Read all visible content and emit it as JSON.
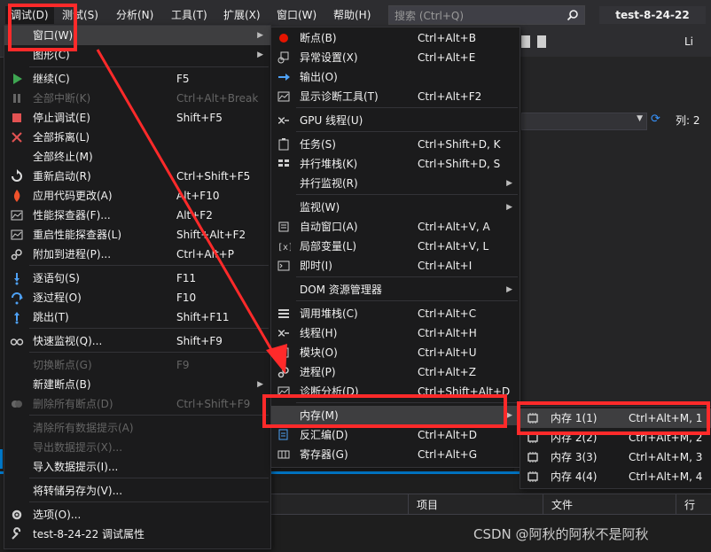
{
  "menubar": {
    "items": [
      {
        "label": "调试(D)"
      },
      {
        "label": "测试(S)"
      },
      {
        "label": "分析(N)"
      },
      {
        "label": "工具(T)"
      },
      {
        "label": "扩展(X)"
      },
      {
        "label": "窗口(W)"
      },
      {
        "label": "帮助(H)"
      }
    ],
    "search_placeholder": "搜索 (Ctrl+Q)",
    "window_title": "test-8-24-22"
  },
  "background": {
    "live_label": "Li",
    "col_label": "列: 2",
    "grid_headers": [
      "项目",
      "文件",
      "行"
    ],
    "watermark": "CSDN @阿秋的阿秋不是阿秋"
  },
  "debug_menu": {
    "items": [
      {
        "label": "窗口(W)",
        "shortcut": "",
        "icon": "",
        "submenu": true
      },
      {
        "label": "图形(C)",
        "shortcut": "",
        "icon": "",
        "submenu": true
      },
      {
        "label": "继续(C)",
        "shortcut": "F5",
        "icon": "play-icon"
      },
      {
        "label": "全部中断(K)",
        "shortcut": "Ctrl+Alt+Break",
        "icon": "pause-icon",
        "disabled": true
      },
      {
        "label": "停止调试(E)",
        "shortcut": "Shift+F5",
        "icon": "stop-icon"
      },
      {
        "label": "全部拆离(L)",
        "shortcut": "",
        "icon": "close-icon"
      },
      {
        "label": "全部终止(M)",
        "shortcut": "",
        "icon": ""
      },
      {
        "label": "重新启动(R)",
        "shortcut": "Ctrl+Shift+F5",
        "icon": "restart-icon"
      },
      {
        "label": "应用代码更改(A)",
        "shortcut": "Alt+F10",
        "icon": "flame-icon"
      },
      {
        "label": "性能探查器(F)...",
        "shortcut": "Alt+F2",
        "icon": "profiler-icon"
      },
      {
        "label": "重启性能探查器(L)",
        "shortcut": "Shift+Alt+F2",
        "icon": "profiler-restart-icon"
      },
      {
        "label": "附加到进程(P)...",
        "shortcut": "Ctrl+Alt+P",
        "icon": "gears-icon"
      },
      {
        "label": "逐语句(S)",
        "shortcut": "F11",
        "icon": "step-into-icon"
      },
      {
        "label": "逐过程(O)",
        "shortcut": "F10",
        "icon": "step-over-icon"
      },
      {
        "label": "跳出(T)",
        "shortcut": "Shift+F11",
        "icon": "step-out-icon"
      },
      {
        "label": "快速监视(Q)...",
        "shortcut": "Shift+F9",
        "icon": "glasses-icon"
      },
      {
        "label": "切换断点(G)",
        "shortcut": "F9",
        "icon": "",
        "disabled": true
      },
      {
        "label": "新建断点(B)",
        "shortcut": "",
        "icon": "",
        "submenu": true
      },
      {
        "label": "删除所有断点(D)",
        "shortcut": "Ctrl+Shift+F9",
        "icon": "breakpoints-icon",
        "disabled": true
      },
      {
        "label": "清除所有数据提示(A)",
        "shortcut": "",
        "icon": "",
        "disabled": true
      },
      {
        "label": "导出数据提示(X)...",
        "shortcut": "",
        "icon": "",
        "disabled": true
      },
      {
        "label": "导入数据提示(I)...",
        "shortcut": "",
        "icon": ""
      },
      {
        "label": "将转储另存为(V)...",
        "shortcut": "",
        "icon": ""
      },
      {
        "label": "选项(O)...",
        "shortcut": "",
        "icon": "gear-icon"
      },
      {
        "label": "test-8-24-22 调试属性",
        "shortcut": "",
        "icon": "wrench-icon"
      }
    ]
  },
  "window_menu": {
    "items": [
      {
        "label": "断点(B)",
        "shortcut": "Ctrl+Alt+B",
        "icon": "breakpoint-icon"
      },
      {
        "label": "异常设置(X)",
        "shortcut": "Ctrl+Alt+E",
        "icon": "exception-icon"
      },
      {
        "label": "输出(O)",
        "shortcut": "",
        "icon": "output-icon"
      },
      {
        "label": "显示诊断工具(T)",
        "shortcut": "Ctrl+Alt+F2",
        "icon": "diagnostics-icon"
      },
      {
        "label": "GPU 线程(U)",
        "shortcut": "",
        "icon": "threads-icon"
      },
      {
        "label": "任务(S)",
        "shortcut": "Ctrl+Shift+D, K",
        "icon": "task-icon"
      },
      {
        "label": "并行堆栈(K)",
        "shortcut": "Ctrl+Shift+D, S",
        "icon": "parallel-stacks-icon"
      },
      {
        "label": "并行监视(R)",
        "shortcut": "",
        "icon": "",
        "submenu": true
      },
      {
        "label": "监视(W)",
        "shortcut": "",
        "icon": "",
        "submenu": true
      },
      {
        "label": "自动窗口(A)",
        "shortcut": "Ctrl+Alt+V, A",
        "icon": "autos-icon"
      },
      {
        "label": "局部变量(L)",
        "shortcut": "Ctrl+Alt+V, L",
        "icon": "locals-icon"
      },
      {
        "label": "即时(I)",
        "shortcut": "Ctrl+Alt+I",
        "icon": "immediate-icon"
      },
      {
        "label": "DOM 资源管理器",
        "shortcut": "",
        "icon": "",
        "submenu": true
      },
      {
        "label": "调用堆栈(C)",
        "shortcut": "Ctrl+Alt+C",
        "icon": "call-stack-icon"
      },
      {
        "label": "线程(H)",
        "shortcut": "Ctrl+Alt+H",
        "icon": "threads-icon"
      },
      {
        "label": "模块(O)",
        "shortcut": "Ctrl+Alt+U",
        "icon": "modules-icon"
      },
      {
        "label": "进程(P)",
        "shortcut": "Ctrl+Alt+Z",
        "icon": "process-icon"
      },
      {
        "label": "诊断分析(D)",
        "shortcut": "Ctrl+Shift+Alt+D",
        "icon": "diagnostics-icon"
      },
      {
        "label": "内存(M)",
        "shortcut": "",
        "icon": "",
        "submenu": true
      },
      {
        "label": "反汇编(D)",
        "shortcut": "Ctrl+Alt+D",
        "icon": "disassembly-icon"
      },
      {
        "label": "寄存器(G)",
        "shortcut": "Ctrl+Alt+G",
        "icon": "registers-icon"
      }
    ]
  },
  "memory_menu": {
    "items": [
      {
        "label": "内存 1(1)",
        "shortcut": "Ctrl+Alt+M, 1",
        "icon": "memory-chip-icon"
      },
      {
        "label": "内存 2(2)",
        "shortcut": "Ctrl+Alt+M, 2",
        "icon": "memory-chip-icon"
      },
      {
        "label": "内存 3(3)",
        "shortcut": "Ctrl+Alt+M, 3",
        "icon": "memory-chip-icon"
      },
      {
        "label": "内存 4(4)",
        "shortcut": "Ctrl+Alt+M, 4",
        "icon": "memory-chip-icon"
      }
    ]
  },
  "colors": {
    "menu_bg": "#1b1b1c",
    "highlight": "#3e3e40",
    "annotation_red": "#ff2a2a",
    "accent_blue": "#007acc"
  }
}
